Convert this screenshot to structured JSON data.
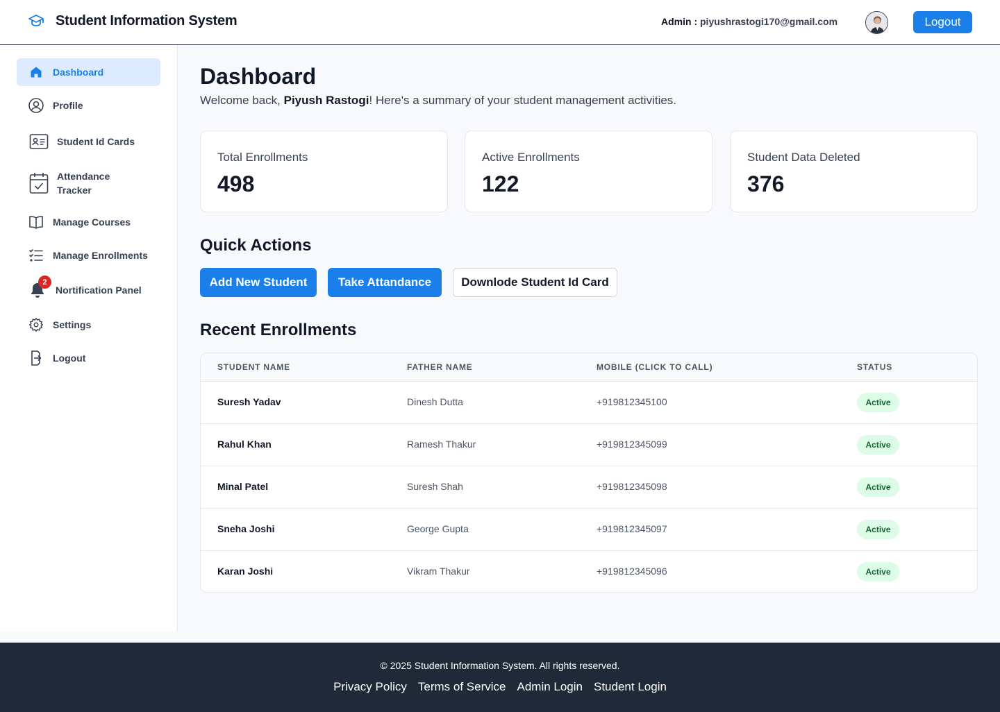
{
  "header": {
    "title": "Student Information System",
    "admin_prefix": "Admin : ",
    "admin_email": "piyushrastogi170@gmail.com",
    "logout_label": "Logout"
  },
  "sidebar": {
    "items": [
      {
        "label": "Dashboard",
        "icon": "home-icon"
      },
      {
        "label": "Profile",
        "icon": "user-circle-icon"
      },
      {
        "label": "Student Id Cards",
        "icon": "id-card-icon"
      },
      {
        "label": "Attendance Tracker",
        "icon": "calendar-check-icon"
      },
      {
        "label": "Manage Courses",
        "icon": "book-icon"
      },
      {
        "label": "Manage Enrollments",
        "icon": "checklist-icon"
      },
      {
        "label": "Nortification Panel",
        "icon": "bell-icon",
        "badge": "2"
      },
      {
        "label": "Settings",
        "icon": "gear-icon"
      },
      {
        "label": "Logout",
        "icon": "logout-icon"
      }
    ]
  },
  "main": {
    "title": "Dashboard",
    "welcome_prefix": "Welcome back, ",
    "welcome_name": "Piyush Rastogi",
    "welcome_suffix": "! Here's a summary of your student management activities.",
    "stats": [
      {
        "label": "Total Enrollments",
        "value": "498"
      },
      {
        "label": "Active Enrollments",
        "value": "122"
      },
      {
        "label": "Student Data Deleted",
        "value": "376"
      }
    ],
    "quick_actions_title": "Quick Actions",
    "quick_actions": [
      "Add New Student",
      "Take Attandance",
      "Downlode Student Id Card"
    ],
    "recent_title": "Recent Enrollments",
    "table": {
      "headers": [
        "STUDENT NAME",
        "FATHER NAME",
        "MOBILE (CLICK TO CALL)",
        "STATUS"
      ],
      "rows": [
        {
          "student": "Suresh Yadav",
          "father": "Dinesh Dutta",
          "mobile": "+919812345100",
          "status": "Active"
        },
        {
          "student": "Rahul Khan",
          "father": "Ramesh Thakur",
          "mobile": "+919812345099",
          "status": "Active"
        },
        {
          "student": "Minal Patel",
          "father": "Suresh Shah",
          "mobile": "+919812345098",
          "status": "Active"
        },
        {
          "student": "Sneha Joshi",
          "father": "George Gupta",
          "mobile": "+919812345097",
          "status": "Active"
        },
        {
          "student": "Karan Joshi",
          "father": "Vikram Thakur",
          "mobile": "+919812345096",
          "status": "Active"
        }
      ]
    }
  },
  "footer": {
    "copyright": "© 2025 Student Information System. All rights reserved.",
    "links": [
      "Privacy Policy",
      "Terms of Service",
      "Admin Login",
      "Student Login"
    ]
  },
  "colors": {
    "accent": "#1a7fe8",
    "active_bg": "#dcebfd",
    "status_bg": "#dcfce7",
    "status_text": "#166534",
    "badge": "#dc2626",
    "footer_bg": "#1f2937"
  }
}
